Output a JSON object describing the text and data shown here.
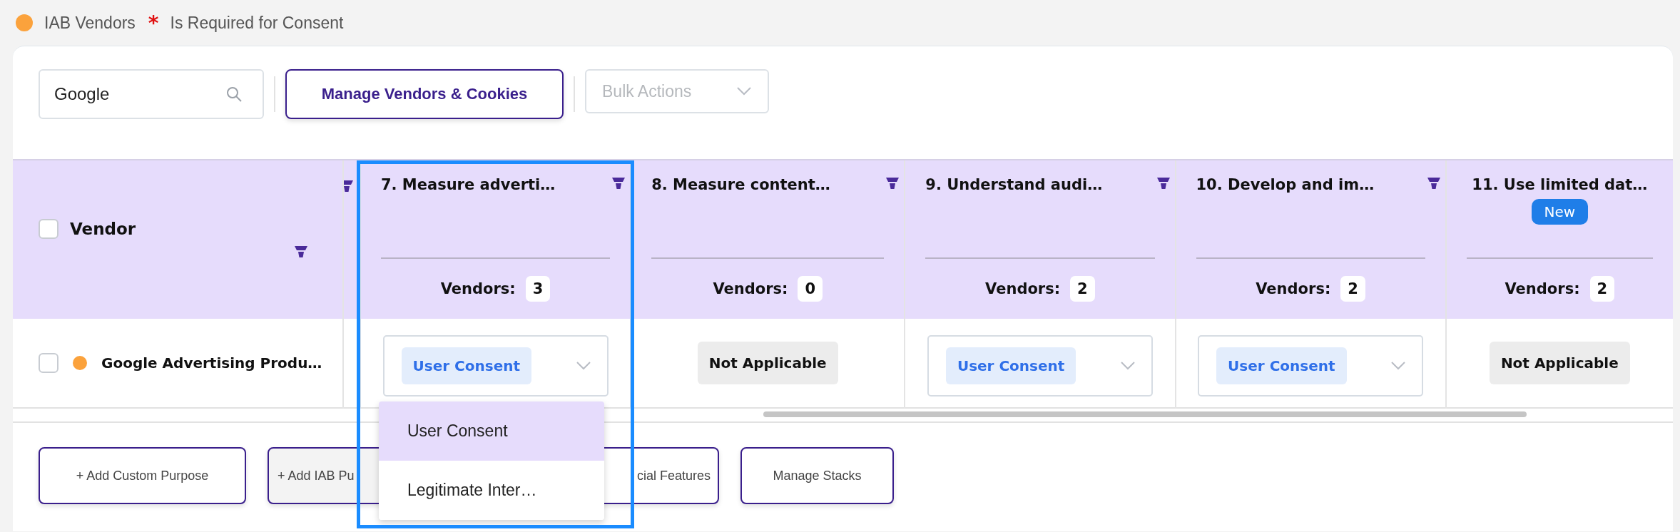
{
  "legend": [
    {
      "kind": "dot",
      "color": "#fba23c",
      "label": "IAB Vendors"
    },
    {
      "kind": "asterisk",
      "symbol": "*",
      "label": "Is Required for Consent"
    }
  ],
  "toolbar": {
    "search": {
      "value": "Google"
    },
    "manage_button": "Manage Vendors & Cookies",
    "bulk_actions": {
      "placeholder": "Bulk Actions",
      "disabled": true
    }
  },
  "table": {
    "vendor_column": {
      "title": "Vendor",
      "checked": false,
      "filter": true
    },
    "columns": [
      {
        "title": "7. Measure adverti…",
        "filter": true,
        "vendors_label": "Vendors:",
        "vendors_count": "3",
        "focused": true
      },
      {
        "title": "8. Measure content…",
        "filter": true,
        "vendors_label": "Vendors:",
        "vendors_count": "0",
        "focused": false
      },
      {
        "title": "9. Understand audi…",
        "filter": true,
        "vendors_label": "Vendors:",
        "vendors_count": "2",
        "focused": false
      },
      {
        "title": "10. Develop and im…",
        "filter": true,
        "vendors_label": "Vendors:",
        "vendors_count": "2",
        "focused": false
      },
      {
        "title": "11. Use limited dat…",
        "badge": "New",
        "filter": false,
        "vendors_label": "Vendors:",
        "vendors_count": "2",
        "focused": false
      }
    ],
    "rows": [
      {
        "checked": false,
        "color": "#fba23c",
        "vendor": "Google Advertising Produ…",
        "cells": [
          {
            "kind": "select",
            "value": "User Consent",
            "expanded": true,
            "options": [
              {
                "label": "User Consent",
                "selected": true
              },
              {
                "label": "Legitimate Inter…",
                "selected": false
              }
            ]
          },
          {
            "kind": "tag",
            "value": "Not Applicable"
          },
          {
            "kind": "select",
            "value": "User Consent"
          },
          {
            "kind": "select",
            "value": "User Consent"
          },
          {
            "kind": "tag",
            "value": "Not Applicable"
          }
        ]
      }
    ]
  },
  "footer_buttons": [
    {
      "label": "+ Add Custom Purpose",
      "disabled": false
    },
    {
      "label": "+ Add IAB Pu",
      "disabled": true
    },
    {
      "label": "cial Features",
      "disabled": false
    },
    {
      "label": "Manage Stacks",
      "disabled": false
    }
  ]
}
